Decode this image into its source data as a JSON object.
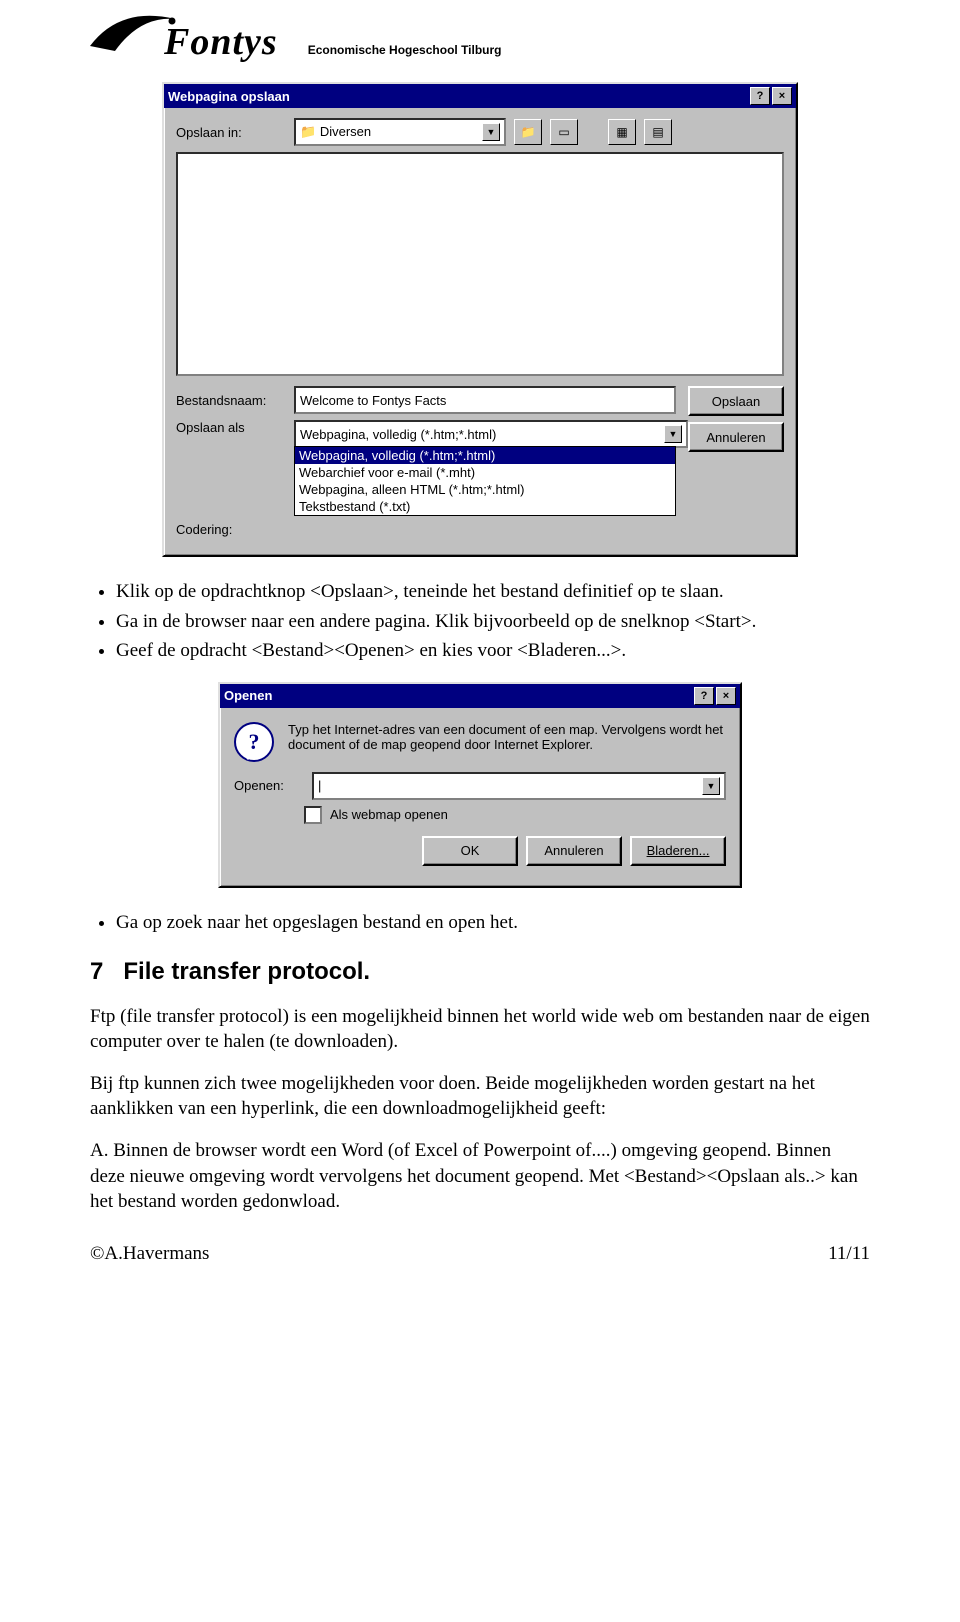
{
  "logo": {
    "brand": "Fontys",
    "sub": "Economische Hogeschool Tilburg"
  },
  "save_dialog": {
    "title": "Webpagina opslaan",
    "save_in_label": "Opslaan in:",
    "save_in_value": "Diversen",
    "filename_label": "Bestandsnaam:",
    "filename_value": "Welcome to Fontys Facts",
    "saveas_label": "Opslaan als",
    "saveas_value": "Webpagina, volledig (*.htm;*.html)",
    "encoding_label": "Codering:",
    "btn_save": "Opslaan",
    "btn_cancel": "Annuleren",
    "options": [
      "Webpagina, volledig (*.htm;*.html)",
      "Webarchief voor e-mail (*.mht)",
      "Webpagina, alleen HTML (*.htm;*.html)",
      "Tekstbestand (*.txt)"
    ]
  },
  "bullets1": [
    "Klik op de opdrachtknop <Opslaan>, teneinde het bestand definitief op te slaan.",
    "Ga in de browser naar een andere pagina. Klik bijvoorbeeld op de snelknop <Start>.",
    "Geef de opdracht <Bestand><Openen> en kies voor <Bladeren...>."
  ],
  "open_dialog": {
    "title": "Openen",
    "hint": "Typ het Internet-adres van een document of een map. Vervolgens wordt het document of de map geopend door Internet Explorer.",
    "open_label": "Openen:",
    "checkbox_label": "Als webmap openen",
    "btn_ok": "OK",
    "btn_cancel": "Annuleren",
    "btn_browse": "Bladeren..."
  },
  "bullets2": [
    "Ga op zoek naar het opgeslagen bestand en open het."
  ],
  "section": {
    "num": "7",
    "title": "File transfer protocol."
  },
  "para1": "Ftp (file transfer protocol) is een mogelijkheid binnen het world wide web om bestanden naar de eigen computer over te halen (te downloaden).",
  "para2": "Bij ftp kunnen zich twee mogelijkheden voor doen. Beide mogelijkheden worden gestart na het aanklikken van een hyperlink, die een downloadmogelijkheid geeft:",
  "para3": "A. Binnen de browser wordt een Word (of Excel of Powerpoint of....) omgeving geopend. Binnen deze nieuwe omgeving wordt vervolgens het document geopend. Met <Bestand><Opslaan als..> kan het bestand worden gedonwload.",
  "footer": {
    "left": "©A.Havermans",
    "right": "11/11"
  }
}
